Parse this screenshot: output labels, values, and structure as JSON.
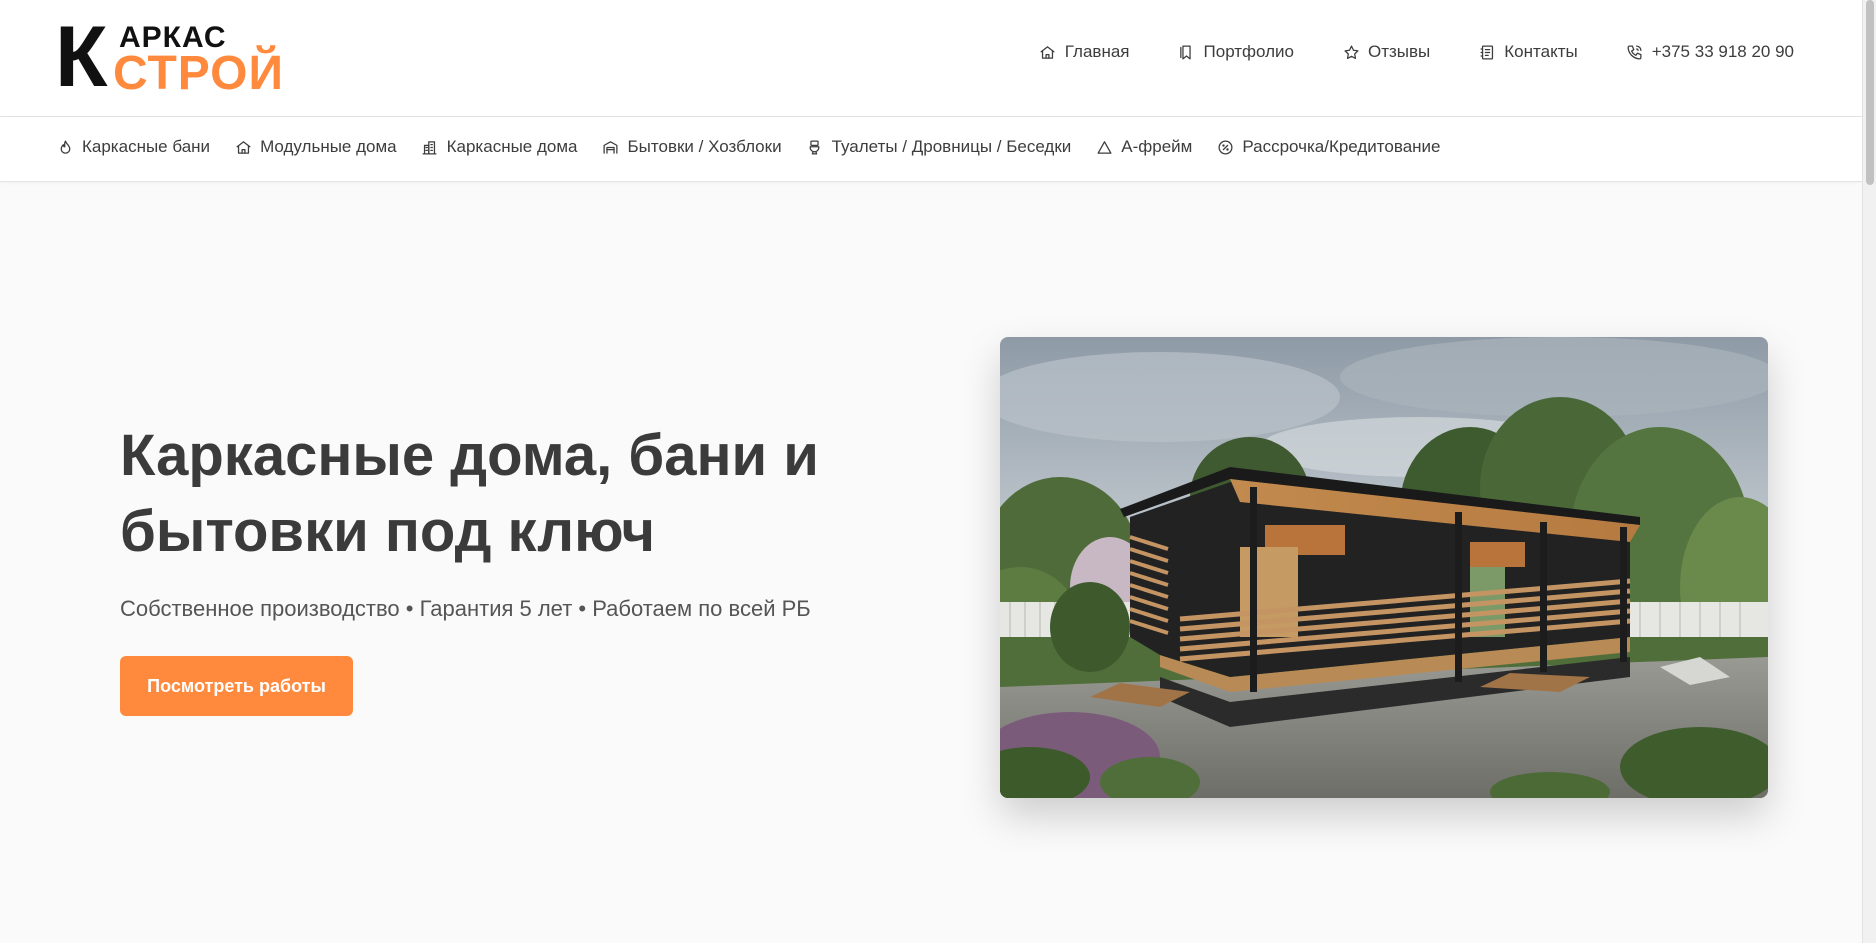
{
  "logo": {
    "letter_k": "К",
    "top_text": "АРКАС",
    "bottom_text": "СТРОЙ"
  },
  "main_nav": [
    {
      "icon": "home-icon",
      "label": "Главная"
    },
    {
      "icon": "bookmark-icon",
      "label": "Портфолио"
    },
    {
      "icon": "star-icon",
      "label": "Отзывы"
    },
    {
      "icon": "contacts-icon",
      "label": "Контакты"
    },
    {
      "icon": "phone-icon",
      "label": "+375 33 918 20 90"
    }
  ],
  "category_nav": [
    {
      "icon": "flame-icon",
      "label": "Каркасные бани"
    },
    {
      "icon": "home-icon",
      "label": "Модульные дома"
    },
    {
      "icon": "building-icon",
      "label": "Каркасные дома"
    },
    {
      "icon": "warehouse-icon",
      "label": "Бытовки / Хозблоки"
    },
    {
      "icon": "toilet-icon",
      "label": "Туалеты / Дровницы / Беседки"
    },
    {
      "icon": "triangle-icon",
      "label": "А-фрейм"
    },
    {
      "icon": "percent-badge-icon",
      "label": "Рассрочка/Кредитование"
    }
  ],
  "hero": {
    "title_line1": "Каркасные дома, бани и",
    "title_line2": "бытовки под ключ",
    "subtitle": "Собственное производство • Гарантия 5 лет • Работаем по всей РБ",
    "button_label": "Посмотреть работы"
  },
  "colors": {
    "accent": "#ff8a3d",
    "text": "#3b3b3b",
    "background": "#fafafa"
  }
}
